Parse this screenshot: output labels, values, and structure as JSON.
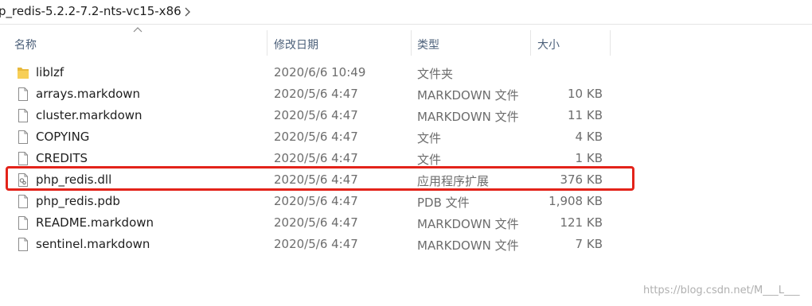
{
  "breadcrumb": {
    "path": "p_redis-5.2.2-7.2-nts-vc15-x86"
  },
  "columns": {
    "name": "名称",
    "modified": "修改日期",
    "type": "类型",
    "size": "大小"
  },
  "files": [
    {
      "name": "liblzf",
      "modified": "2020/6/6 10:49",
      "type": "文件夹",
      "size": "",
      "icon": "folder-icon"
    },
    {
      "name": "arrays.markdown",
      "modified": "2020/5/6 4:47",
      "type": "MARKDOWN 文件",
      "size": "10 KB",
      "icon": "file-icon"
    },
    {
      "name": "cluster.markdown",
      "modified": "2020/5/6 4:47",
      "type": "MARKDOWN 文件",
      "size": "11 KB",
      "icon": "file-icon"
    },
    {
      "name": "COPYING",
      "modified": "2020/5/6 4:47",
      "type": "文件",
      "size": "4 KB",
      "icon": "file-icon"
    },
    {
      "name": "CREDITS",
      "modified": "2020/5/6 4:47",
      "type": "文件",
      "size": "1 KB",
      "icon": "file-icon"
    },
    {
      "name": "php_redis.dll",
      "modified": "2020/5/6 4:47",
      "type": "应用程序扩展",
      "size": "376 KB",
      "icon": "dll-icon"
    },
    {
      "name": "php_redis.pdb",
      "modified": "2020/5/6 4:47",
      "type": "PDB 文件",
      "size": "1,908 KB",
      "icon": "file-icon"
    },
    {
      "name": "README.markdown",
      "modified": "2020/5/6 4:47",
      "type": "MARKDOWN 文件",
      "size": "121 KB",
      "icon": "file-icon"
    },
    {
      "name": "sentinel.markdown",
      "modified": "2020/5/6 4:47",
      "type": "MARKDOWN 文件",
      "size": "7 KB",
      "icon": "file-icon"
    }
  ],
  "watermark": "https://blog.csdn.net/M___L___"
}
